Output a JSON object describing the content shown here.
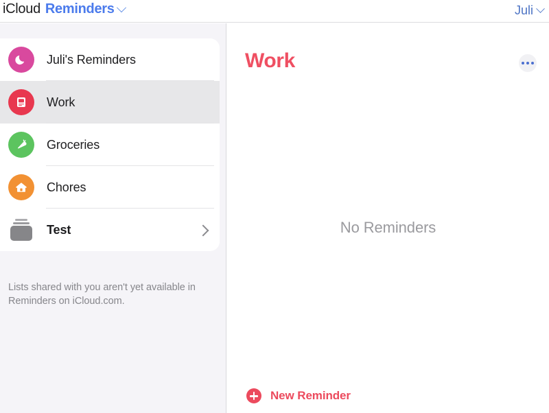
{
  "header": {
    "brand_prefix": "iCloud",
    "brand_app": "Reminders",
    "app_chevron_icon": "chevron-down-icon",
    "account_name": "Juli",
    "account_chevron_icon": "chevron-down-icon",
    "brand_app_color": "#4b7bec",
    "account_color": "#4c73c4"
  },
  "sidebar": {
    "items": [
      {
        "label": "Juli's Reminders",
        "icon": "moon-icon",
        "icon_color": "#d9499e",
        "selected": false,
        "bold": false,
        "has_chevron": false
      },
      {
        "label": "Work",
        "icon": "computer-icon",
        "icon_color": "#e8384f",
        "selected": true,
        "bold": false,
        "has_chevron": false
      },
      {
        "label": "Groceries",
        "icon": "carrot-icon",
        "icon_color": "#5cc45f",
        "selected": false,
        "bold": false,
        "has_chevron": false
      },
      {
        "label": "Chores",
        "icon": "house-icon",
        "icon_color": "#f29133",
        "selected": false,
        "bold": false,
        "has_chevron": false
      },
      {
        "label": "Test",
        "icon": "group-folder-icon",
        "icon_color": "#868689",
        "selected": false,
        "bold": true,
        "has_chevron": true
      }
    ],
    "note": "Lists shared with you aren't yet available in Reminders on iCloud.com."
  },
  "main": {
    "title": "Work",
    "title_color": "#ef4f62",
    "more_button_icon": "ellipsis-icon",
    "empty_state": "No Reminders",
    "new_reminder_label": "New Reminder",
    "new_reminder_icon": "plus-circle-icon",
    "accent_color": "#ec4a5d"
  }
}
